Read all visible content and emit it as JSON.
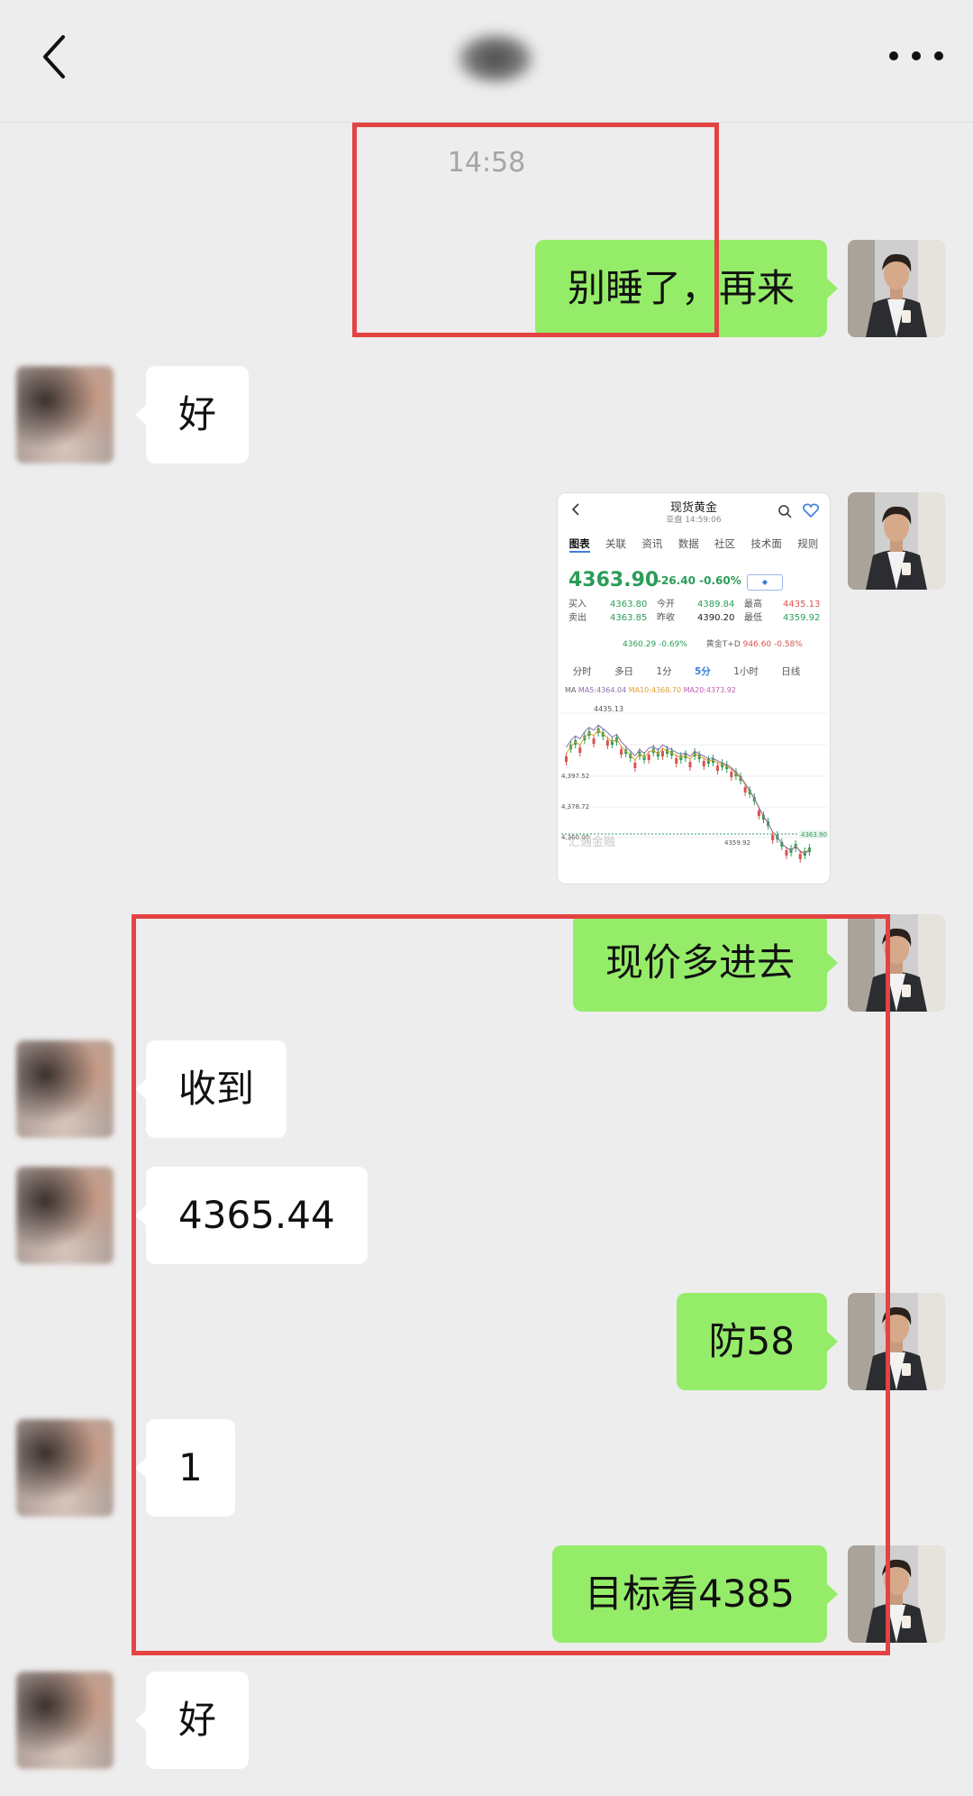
{
  "time_label": "14:58",
  "messages": [
    {
      "side": "me",
      "text": "别睡了，再来"
    },
    {
      "side": "other",
      "text": "好"
    },
    {
      "side": "me",
      "type": "image",
      "image_kind": "trading-app-screenshot"
    },
    {
      "side": "me",
      "text": "现价多进去"
    },
    {
      "side": "other",
      "text": "收到"
    },
    {
      "side": "other",
      "text": "4365.44"
    },
    {
      "side": "me",
      "text": "防58"
    },
    {
      "side": "other",
      "text": "1"
    },
    {
      "side": "me",
      "text": "目标看4385"
    },
    {
      "side": "other",
      "text": "好"
    }
  ],
  "screenshot": {
    "title": "现货黄金",
    "subtitle": "亚盘 14:59:06",
    "tabs": [
      "图表",
      "关联",
      "资讯",
      "数据",
      "社区",
      "技术面",
      "规则"
    ],
    "active_tab": "图表",
    "price": "4363.90",
    "change": "-26.40",
    "change_pct": "-0.60%",
    "quote": {
      "buy_label": "买入",
      "buy": "4363.80",
      "sell_label": "卖出",
      "sell": "4363.85",
      "open_label": "今开",
      "open": "4389.84",
      "prev_label": "昨收",
      "prev": "4390.20",
      "high_label": "最高",
      "high": "4435.13",
      "low_label": "最低",
      "low": "4359.92"
    },
    "related_left": "4360.29 -0.69%",
    "related_right_label": "黄金T+D",
    "related_right": "946.60 -0.58%",
    "periods": [
      "分时",
      "多日",
      "1分",
      "5分",
      "1小时",
      "日线"
    ],
    "active_period": "5分",
    "ma_label": "MA",
    "ma5": "MA5:4364.04",
    "ma10": "MA10:4368.70",
    "ma20": "MA20:4373.92",
    "axis_labels": [
      "4435.13",
      "4,397.52",
      "4,378.72",
      "4,360.00"
    ],
    "last_price_tag": "4363.90",
    "low_tag": "4359.92",
    "watermark": "汇通金融"
  },
  "colors": {
    "my_bubble": "#95ec69",
    "their_bubble": "#ffffff",
    "background": "#ededed",
    "highlight_box": "#e34343",
    "price_down": "#2a9d58",
    "price_up": "#d9534f"
  }
}
